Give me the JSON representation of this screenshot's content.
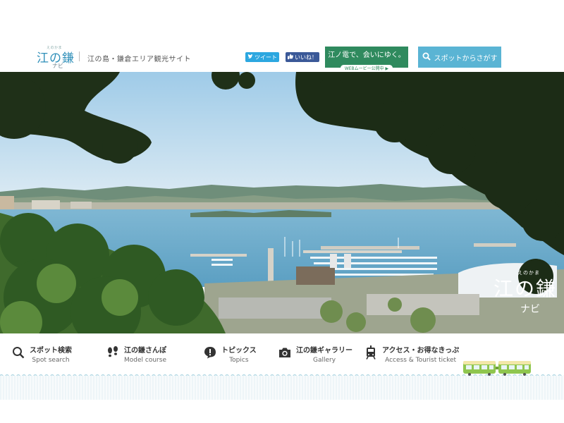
{
  "header": {
    "logo_small": "えのかま",
    "logo_main": "江の鎌",
    "logo_sub": "ナビ",
    "tagline": "江の島・鎌倉エリア観光サイト",
    "tweet_label": "ツイート",
    "like_label": "いいね！",
    "banner_main": "江ノ電で、会いにゆく。",
    "banner_sub": "WEBムービー公開中 ▶",
    "search_label": "スポットからさがす"
  },
  "hero": {
    "logo_small": "えのかま",
    "logo_main": "江の鎌",
    "logo_sub": "ナビ"
  },
  "nav": {
    "items": [
      {
        "jp": "スポット検索",
        "en": "Spot search",
        "icon": "search-icon"
      },
      {
        "jp": "江の鎌さんぽ",
        "en": "Model course",
        "icon": "footprints-icon"
      },
      {
        "jp": "トピックス",
        "en": "Topics",
        "icon": "exclamation-bubble-icon"
      },
      {
        "jp": "江の鎌ギャラリー",
        "en": "Gallery",
        "icon": "camera-icon"
      },
      {
        "jp": "アクセス・お得なきっぷ",
        "en": "Access & Tourist ticket",
        "icon": "tram-icon"
      }
    ]
  },
  "colors": {
    "tweet": "#2ca7e0",
    "like": "#3b5998",
    "banner": "#2f8a5e",
    "search": "#5ab4d4",
    "train": "#8fc64f"
  }
}
